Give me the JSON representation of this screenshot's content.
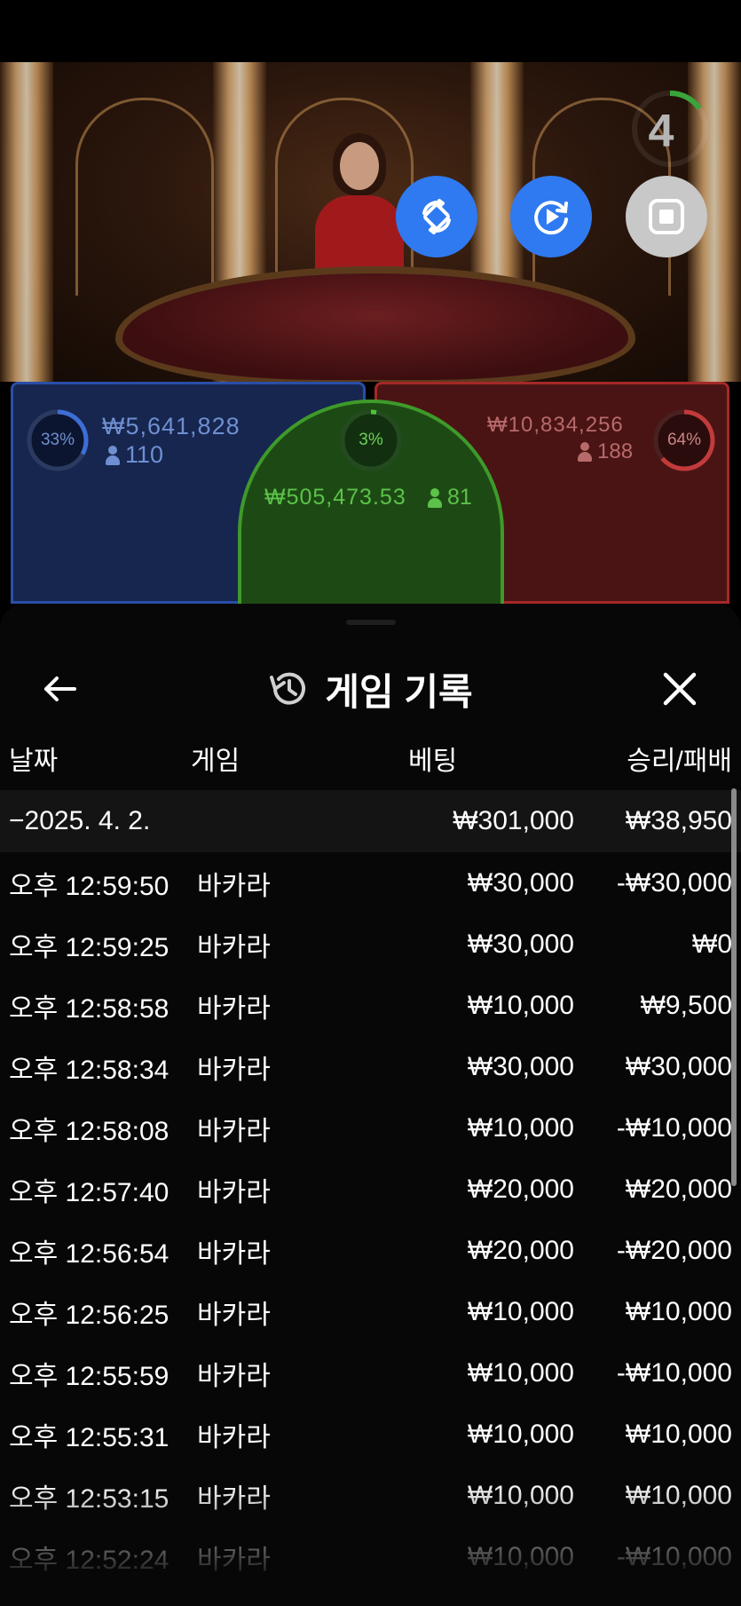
{
  "video": {
    "timer_value": "4",
    "buttons": [
      "rotate-view-icon",
      "replay-icon",
      "stop-icon"
    ]
  },
  "betting": {
    "player": {
      "percent": "33%",
      "amount": "₩5,641,828",
      "players": "110",
      "color": "#2a4ea8",
      "percent_value": 0.33
    },
    "tie": {
      "percent": "3%",
      "amount": "₩505,473.53",
      "players": "81",
      "color": "#3e9a2a",
      "percent_value": 0.03
    },
    "banker": {
      "percent": "64%",
      "amount": "₩10,834,256",
      "players": "188",
      "color": "#a62828",
      "percent_value": 0.64
    }
  },
  "sheet": {
    "title": "게임 기록",
    "columns": {
      "date": "날짜",
      "game": "게임",
      "bet": "베팅",
      "result": "승리/패배"
    },
    "date_group": {
      "label": "−2025. 4. 2.",
      "bet_total": "₩301,000",
      "result_total": "₩38,950"
    },
    "rows": [
      {
        "time": "오후 12:59:50",
        "game": "바카라",
        "bet": "₩30,000",
        "result": "-₩30,000"
      },
      {
        "time": "오후 12:59:25",
        "game": "바카라",
        "bet": "₩30,000",
        "result": "₩0"
      },
      {
        "time": "오후 12:58:58",
        "game": "바카라",
        "bet": "₩10,000",
        "result": "₩9,500"
      },
      {
        "time": "오후 12:58:34",
        "game": "바카라",
        "bet": "₩30,000",
        "result": "₩30,000"
      },
      {
        "time": "오후 12:58:08",
        "game": "바카라",
        "bet": "₩10,000",
        "result": "-₩10,000"
      },
      {
        "time": "오후 12:57:40",
        "game": "바카라",
        "bet": "₩20,000",
        "result": "₩20,000"
      },
      {
        "time": "오후 12:56:54",
        "game": "바카라",
        "bet": "₩20,000",
        "result": "-₩20,000"
      },
      {
        "time": "오후 12:56:25",
        "game": "바카라",
        "bet": "₩10,000",
        "result": "₩10,000"
      },
      {
        "time": "오후 12:55:59",
        "game": "바카라",
        "bet": "₩10,000",
        "result": "-₩10,000"
      },
      {
        "time": "오후 12:55:31",
        "game": "바카라",
        "bet": "₩10,000",
        "result": "₩10,000"
      },
      {
        "time": "오후 12:53:15",
        "game": "바카라",
        "bet": "₩10,000",
        "result": "₩10,000"
      },
      {
        "time": "오후 12:52:24",
        "game": "바카라",
        "bet": "₩10,000",
        "result": "-₩10,000"
      }
    ]
  },
  "colors": {
    "accent_blue": "#2f7af0",
    "sheet_bg": "#070707",
    "date_row_bg": "#141414"
  }
}
